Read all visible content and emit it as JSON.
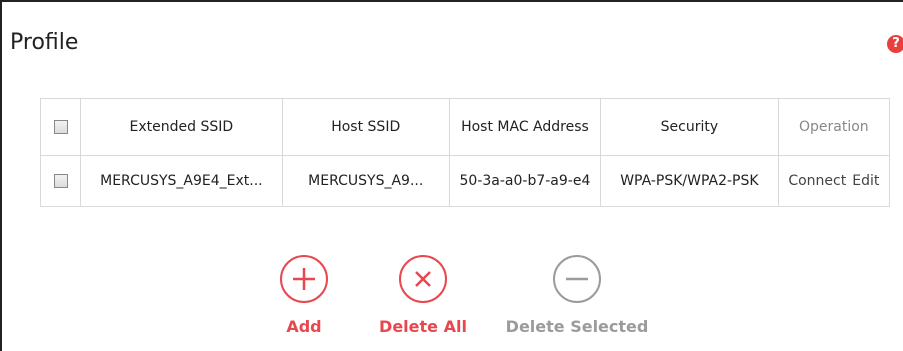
{
  "page": {
    "title": "Profile",
    "help_icon": "?"
  },
  "table": {
    "headers": {
      "extended_ssid": "Extended SSID",
      "host_ssid": "Host SSID",
      "host_mac": "Host MAC Address",
      "security": "Security",
      "operation": "Operation"
    },
    "rows": [
      {
        "extended_ssid": "MERCUSYS_A9E4_Ext...",
        "host_ssid": "MERCUSYS_A9...",
        "host_mac": "50-3a-a0-b7-a9-e4",
        "security": "WPA-PSK/WPA2-PSK",
        "connect": "Connect",
        "edit": "Edit"
      }
    ]
  },
  "actions": {
    "add": "Add",
    "delete_all": "Delete All",
    "delete_selected": "Delete Selected"
  },
  "colors": {
    "accent_red": "#e8474f",
    "disabled_grey": "#9b9b9b"
  }
}
